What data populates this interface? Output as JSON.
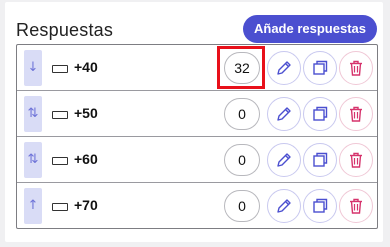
{
  "header": {
    "title": "Respuestas",
    "add_button_label": "Añade respuestas"
  },
  "rows": [
    {
      "handle_icon": "↓",
      "label": "+40",
      "count": "32",
      "highlighted": true
    },
    {
      "handle_icon": "⇅",
      "label": "+50",
      "count": "0",
      "highlighted": false
    },
    {
      "handle_icon": "⇅",
      "label": "+60",
      "count": "0",
      "highlighted": false
    },
    {
      "handle_icon": "↑",
      "label": "+70",
      "count": "0",
      "highlighted": false
    }
  ],
  "colors": {
    "accent": "#4b4fd0",
    "delete": "#d6336c",
    "highlight": "#e8101a"
  },
  "icons": [
    "sort-arrow-icon",
    "keyboard-icon",
    "pencil-icon",
    "duplicate-icon",
    "trash-icon"
  ]
}
